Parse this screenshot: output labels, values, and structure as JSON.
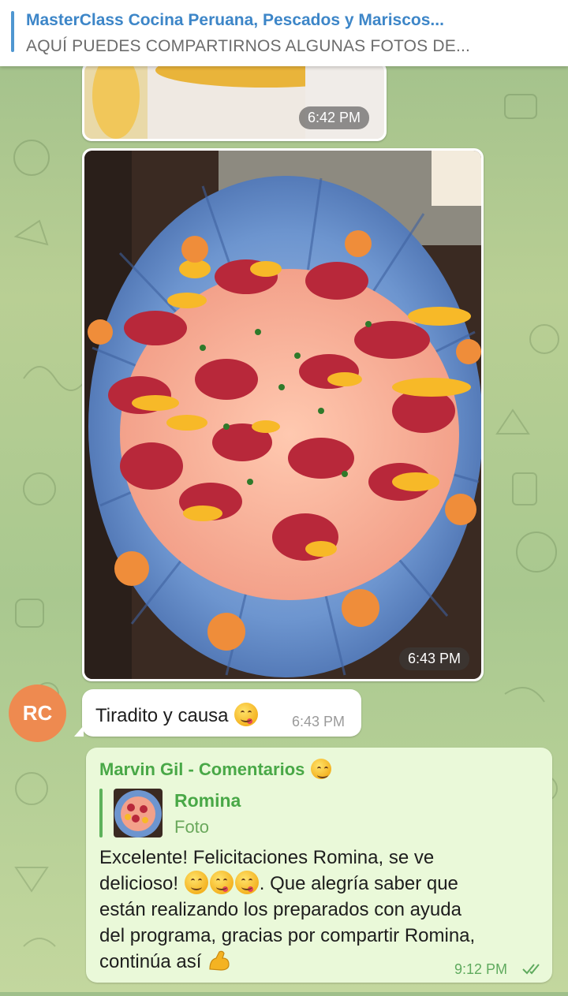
{
  "pinned": {
    "title": "MasterClass Cocina Peruana, Pescados y Mariscos...",
    "subtitle": "AQUÍ PUEDES COMPARTIRNOS ALGUNAS FOTOS DE..."
  },
  "messages": {
    "photo1_time": "6:42 PM",
    "photo2_time": "6:43 PM",
    "sender_initials": "RC",
    "caption": "Tiradito y causa",
    "caption_time": "6:43 PM",
    "reply": {
      "author": "Marvin Gil - Comentarios",
      "quoted_name": "Romina",
      "quoted_type": "Foto",
      "text_line1": "Excelente! Felicitaciones Romina, se ve",
      "text_line2a": "delicioso!",
      "text_line2b": ". Que alegría saber que",
      "text_line3": "están realizando los preparados con ayuda",
      "text_line4": "del programa, gracias por compartir Romina,",
      "text_line5": "continúa así",
      "time": "9:12 PM"
    }
  },
  "colors": {
    "accent_blue": "#3d86c8",
    "accent_green": "#49a847",
    "avatar_orange": "#ee8a50",
    "outgoing_bubble": "#eaf9d9"
  },
  "icons": [
    "yum-emoji",
    "smile-emoji",
    "flexed-biceps-emoji",
    "double-check-icon"
  ]
}
